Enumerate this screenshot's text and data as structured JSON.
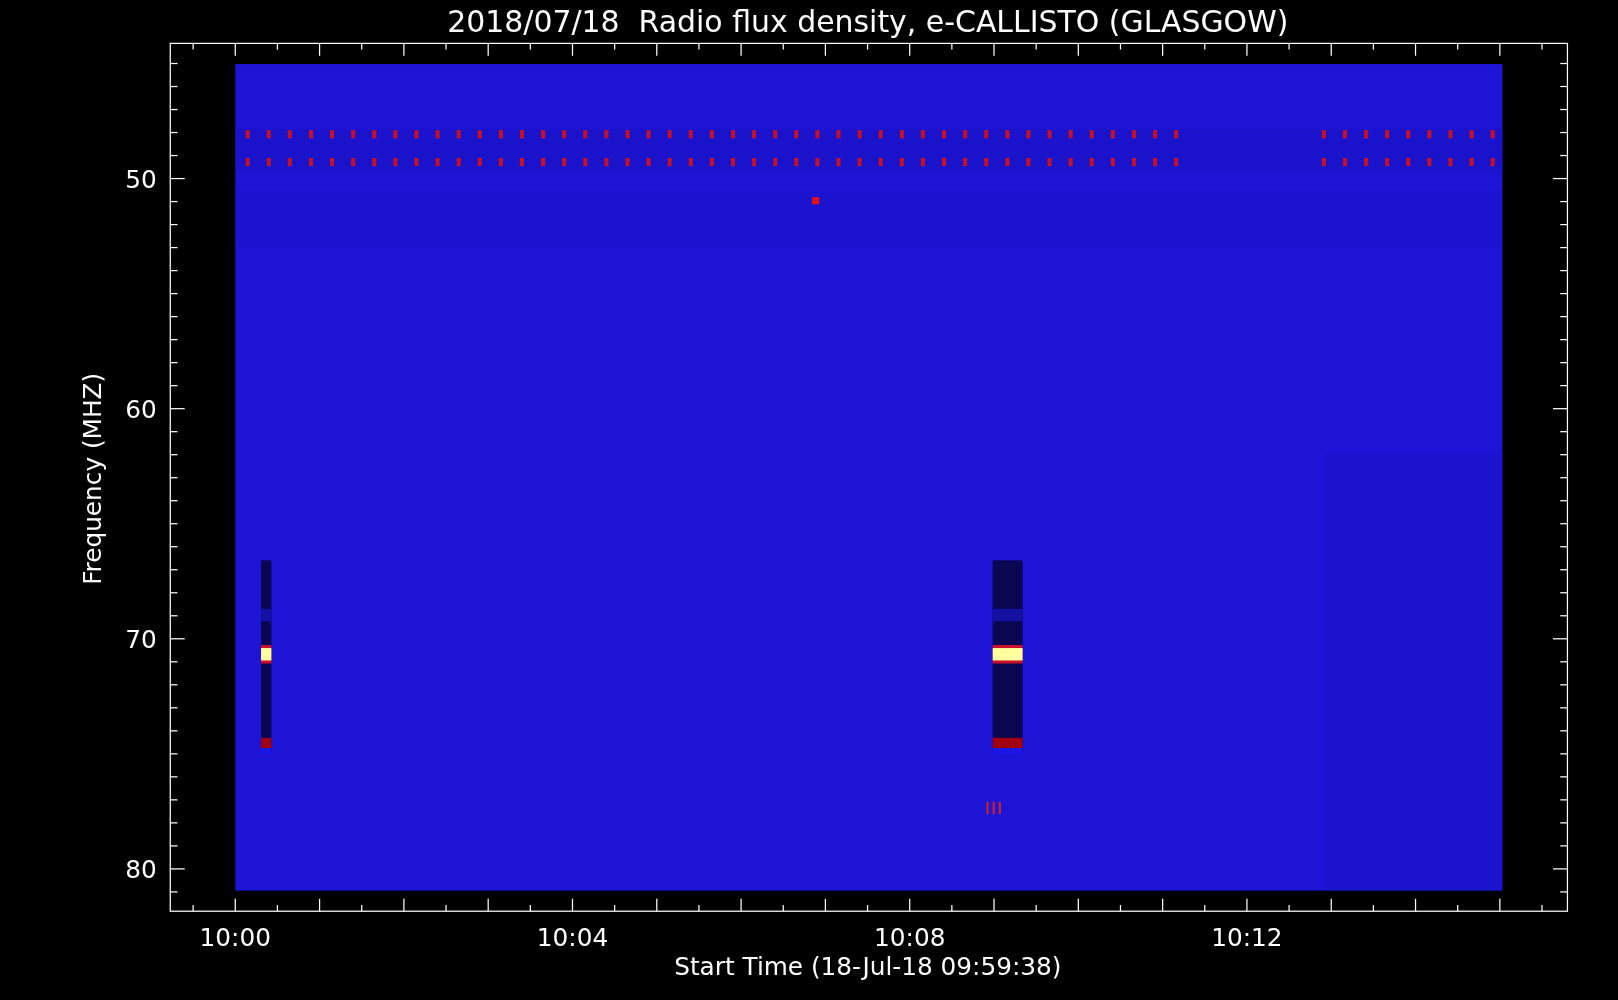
{
  "title": "2018/07/18  Radio flux density, e-CALLISTO (GLASGOW)",
  "x_axis": {
    "label": "Start Time (18-Jul-18 09:59:38)",
    "ticks": [
      "10:00",
      "10:04",
      "10:08",
      "10:12"
    ]
  },
  "y_axis": {
    "label": "Frequency (MHZ)",
    "ticks": [
      "50",
      "60",
      "70",
      "80"
    ]
  }
}
